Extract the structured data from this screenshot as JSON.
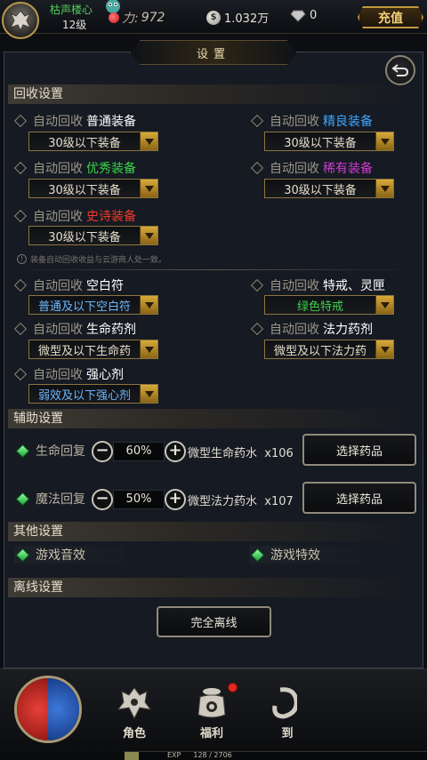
{
  "player": {
    "name": "枯声楼心",
    "level": "12级",
    "power": "972",
    "gold": "1.032万",
    "gems": "0",
    "recharge_label": "充值"
  },
  "panel": {
    "title": "设置"
  },
  "recycle": {
    "section_title": "回收设置",
    "prefix": "自动回收",
    "items": [
      {
        "quality": "普通装备",
        "color": "#ffffff",
        "value": "30级以下装备"
      },
      {
        "quality": "精良装备",
        "color": "#3fa7ff",
        "value": "30级以下装备"
      },
      {
        "quality": "优秀装备",
        "color": "#38d64a",
        "value": "30级以下装备"
      },
      {
        "quality": "稀有装备",
        "color": "#d13ad6",
        "value": "30级以下装备"
      },
      {
        "quality": "史诗装备",
        "color": "#f23a2a",
        "value": "30级以下装备"
      }
    ],
    "note": "装备自动回收收益与云游商人处一致。",
    "consumables": [
      {
        "name": "空白符",
        "value": "普通及以下空白符",
        "value_color": "#6bb7ff"
      },
      {
        "name": "特戒、灵匣",
        "value": "绿色特戒",
        "value_color": "#3ccf4a"
      },
      {
        "name": "生命药剂",
        "value": "微型及以下生命药",
        "value_color": "#e4ddca"
      },
      {
        "name": "法力药剂",
        "value": "微型及以下法力药",
        "value_color": "#e4ddca"
      },
      {
        "name": "强心剂",
        "value": "弱效及以下强心剂",
        "value_color": "#6bb7ff"
      }
    ]
  },
  "aux": {
    "section_title": "辅助设置",
    "hp": {
      "label": "生命回复",
      "percent": "60%",
      "potion": "微型生命药水",
      "count": "x106",
      "button": "选择药品"
    },
    "mp": {
      "label": "魔法回复",
      "percent": "50%",
      "potion": "微型法力药水",
      "count": "x107",
      "button": "选择药品"
    },
    "minus": "−",
    "plus": "+"
  },
  "other": {
    "section_title": "其他设置",
    "sound": "游戏音效",
    "effects": "游戏特效"
  },
  "offline": {
    "section_title": "离线设置",
    "button": "完全离线"
  },
  "hud": {
    "role_label": "角色",
    "welfare_label": "福利",
    "partial_label": "到",
    "exp_label": "EXP",
    "exp_value": "128 / 2706",
    "exp_fraction": 0.047
  }
}
